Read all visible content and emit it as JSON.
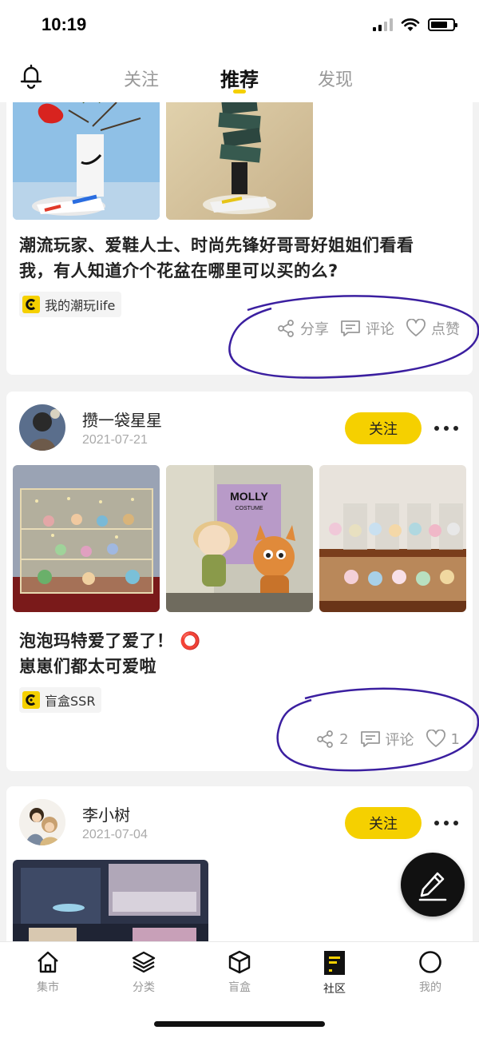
{
  "status_bar": {
    "time": "10:19"
  },
  "top_nav": {
    "tabs": [
      {
        "label": "关注",
        "active": false
      },
      {
        "label": "推荐",
        "active": true
      },
      {
        "label": "发现",
        "active": false
      }
    ],
    "accent_color": "#F5D000"
  },
  "posts": [
    {
      "text_lines": [
        "潮流玩家、爱鞋人士、时尚先锋好哥哥好姐姐们看看",
        "我，有人知道介个花盆在哪里可以买的么?"
      ],
      "tag": "我的潮玩life",
      "actions": {
        "share": "分享",
        "comment": "评论",
        "like": "点赞"
      }
    },
    {
      "user": "攒一袋星星",
      "date": "2021-07-21",
      "follow_label": "关注",
      "text_lines": [
        "泡泡玛特爱了爱了！ ⭕",
        "崽崽们都太可爱啦"
      ],
      "tag": "盲盒SSR",
      "actions": {
        "share": "2",
        "comment": "评论",
        "like": "1"
      },
      "image_text": [
        "MOLLY",
        "COSTUME"
      ]
    },
    {
      "user": "李小树",
      "date": "2021-07-04",
      "follow_label": "关注"
    }
  ],
  "bottom_nav": {
    "items": [
      {
        "label": "集市",
        "icon": "home-icon",
        "active": false
      },
      {
        "label": "分类",
        "icon": "layers-icon",
        "active": false
      },
      {
        "label": "盲盒",
        "icon": "box-icon",
        "active": false
      },
      {
        "label": "社区",
        "icon": "community-icon",
        "active": true
      },
      {
        "label": "我的",
        "icon": "profile-icon",
        "active": false
      }
    ]
  }
}
